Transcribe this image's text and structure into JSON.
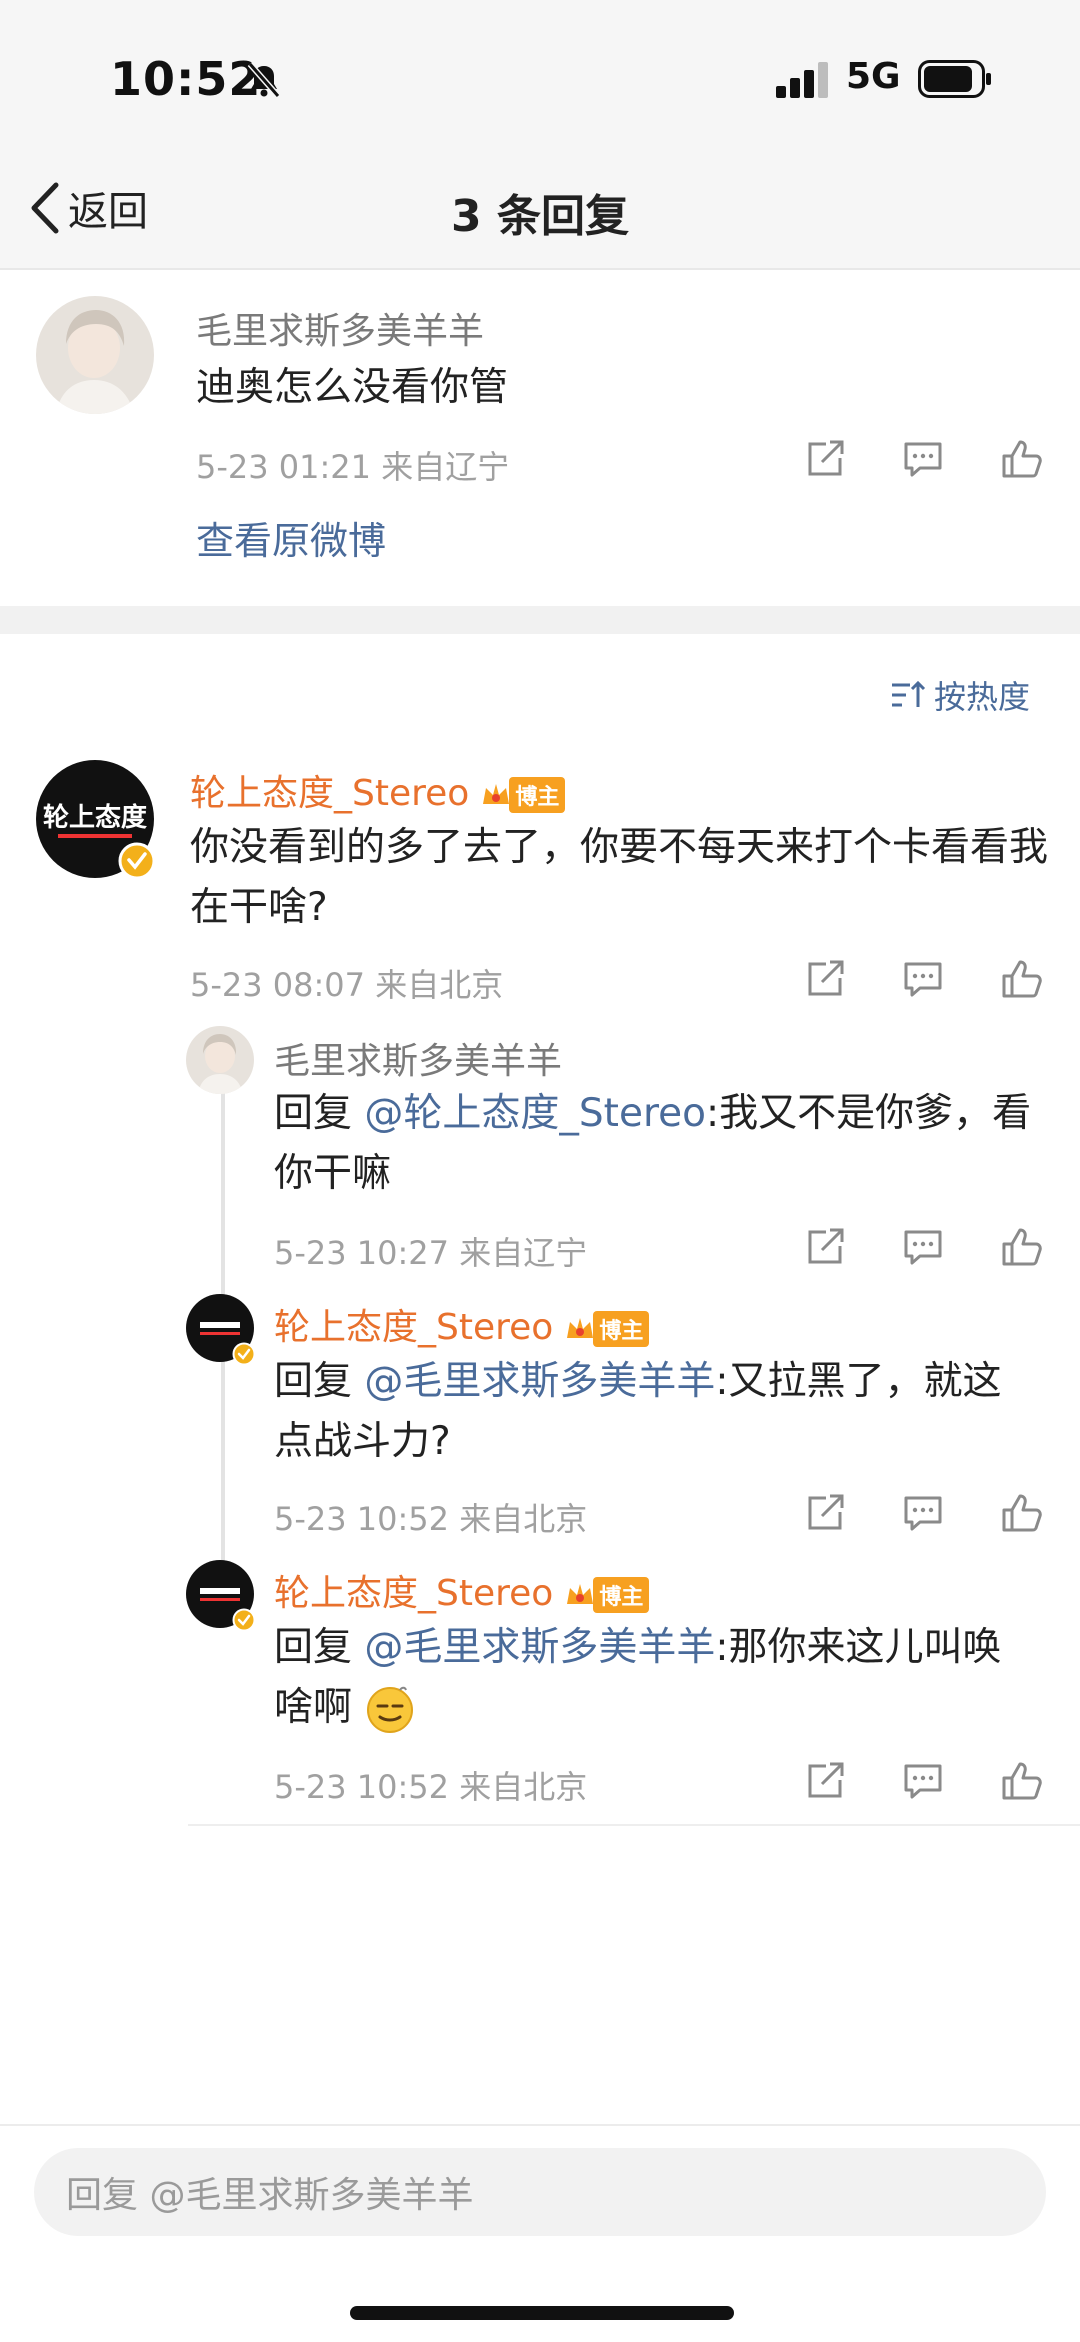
{
  "status_bar": {
    "time": "10:52",
    "network": "5G",
    "icons": [
      "bell-slash-icon",
      "signal-icon",
      "battery-icon"
    ]
  },
  "nav": {
    "back_label": "返回",
    "title": "3 条回复"
  },
  "original_comment": {
    "author": "毛里求斯多美羊羊",
    "text": "迪奥怎么没看你管",
    "meta": "5-23 01:21 来自辽宁",
    "view_original": "查看原微博"
  },
  "sort": {
    "label": "按热度"
  },
  "main_comment": {
    "author": "轮上态度_Stereo",
    "badge": "博主",
    "text": "你没看到的多了去了，你要不每天来打个卡看看我在干啥?",
    "meta": "5-23 08:07 来自北京",
    "avatar_text": "轮上态度"
  },
  "replies": [
    {
      "author": "毛里求斯多美羊羊",
      "reply_prefix": "回复 ",
      "mention": "@轮上态度_Stereo",
      "text": ":我又不是你爹，看你干嘛",
      "meta": "5-23 10:27 来自辽宁"
    },
    {
      "author": "轮上态度_Stereo",
      "badge": "博主",
      "reply_prefix": "回复 ",
      "mention": "@毛里求斯多美羊羊",
      "text": ":又拉黑了，就这点战斗力?",
      "meta": "5-23 10:52 来自北京"
    },
    {
      "author": "轮上态度_Stereo",
      "badge": "博主",
      "reply_prefix": "回复 ",
      "mention": "@毛里求斯多美羊羊",
      "text": ":那你来这儿叫唤啥啊",
      "meta": "5-23 10:52 来自北京"
    }
  ],
  "reply_input": {
    "placeholder": "回复 @毛里求斯多美羊羊"
  },
  "colors": {
    "accent_link": "#4a6b9a",
    "blogger_name": "#e8712d",
    "badge": "#f7a020"
  }
}
